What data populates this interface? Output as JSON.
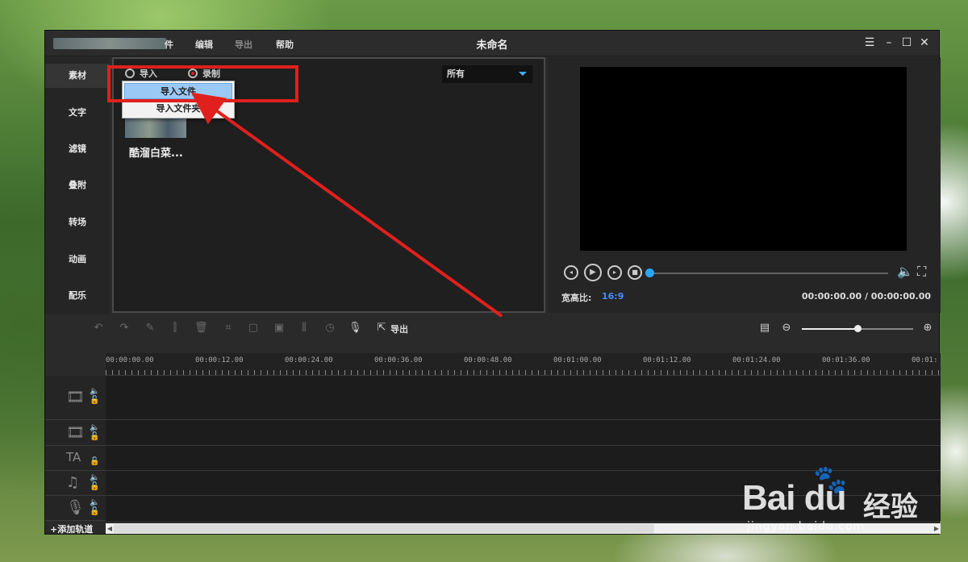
{
  "menu": {
    "partial_first": "件",
    "edit": "编辑",
    "export": "导出",
    "help": "帮助"
  },
  "window": {
    "title": "未命名",
    "menu_icon": "☰",
    "minimize_icon": "–",
    "maximize_icon": "☐",
    "close_icon": "✕"
  },
  "sidebar": {
    "items": [
      {
        "label": "素材"
      },
      {
        "label": "文字"
      },
      {
        "label": "滤镜"
      },
      {
        "label": "叠附"
      },
      {
        "label": "转场"
      },
      {
        "label": "动画"
      },
      {
        "label": "配乐"
      }
    ]
  },
  "media": {
    "import_label": "导入",
    "record_label": "录制",
    "filter_value": "所有",
    "dropdown": {
      "items": [
        {
          "label": "导入文件"
        },
        {
          "label": "导入文件夹"
        }
      ]
    },
    "clip_label": "酷溜白菜..."
  },
  "preview": {
    "aspect_label": "宽高比:",
    "aspect_value": "16:9",
    "timecode": "00:00:00.00 / 00:00:00.00",
    "progress": 0
  },
  "timeline": {
    "export_label": "导出",
    "zoom_level": 0.5,
    "ruler_labels": [
      "00:00:00.00",
      "00:00:12.00",
      "00:00:24.00",
      "00:00:36.00",
      "00:00:48.00",
      "00:01:00.00",
      "00:01:12.00",
      "00:01:24.00",
      "00:01:36.00",
      "00:01:"
    ],
    "add_track_label": "+添加轨道"
  },
  "watermark": {
    "brand": "Bai du",
    "cn": "经验",
    "url": "jingyan.baidu.com"
  },
  "colors": {
    "accent": "#29a7ff",
    "highlight_box": "#e0201c",
    "aspect_value": "#4a8cff"
  }
}
